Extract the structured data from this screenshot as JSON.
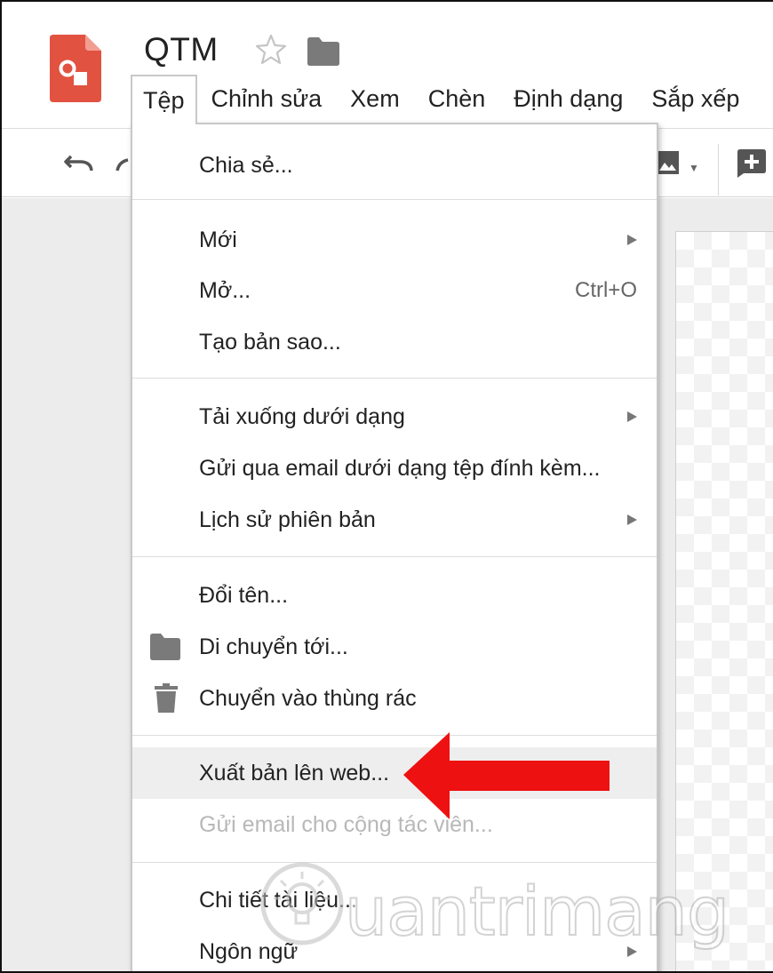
{
  "header": {
    "doc_title": "QTM",
    "icons": [
      "slides-logo-icon",
      "star-icon",
      "folder-icon"
    ]
  },
  "menubar": {
    "items": [
      {
        "label": "Tệp",
        "active": true
      },
      {
        "label": "Chỉnh sửa"
      },
      {
        "label": "Xem"
      },
      {
        "label": "Chèn"
      },
      {
        "label": "Định dạng"
      },
      {
        "label": "Sắp xếp"
      }
    ]
  },
  "toolbar": {
    "icons": [
      "undo-icon",
      "redo-icon",
      "image-icon",
      "add-comment-icon"
    ]
  },
  "file_menu": {
    "share": "Chia sẻ...",
    "new": "Mới",
    "open": "Mở...",
    "open_shortcut": "Ctrl+O",
    "make_copy": "Tạo bản sao...",
    "download_as": "Tải xuống dưới dạng",
    "email_attachment": "Gửi qua email dưới dạng tệp đính kèm...",
    "version_history": "Lịch sử phiên bản",
    "rename": "Đổi tên...",
    "move_to": "Di chuyển tới...",
    "move_to_trash": "Chuyển vào thùng rác",
    "publish_to_web": "Xuất bản lên web...",
    "email_collaborators": "Gửi email cho cộng tác viên...",
    "document_details": "Chi tiết tài liệu...",
    "language": "Ngôn ngữ"
  },
  "watermark": {
    "text": "uantrimang"
  },
  "colors": {
    "slides_brand": "#e25241",
    "arrow_red": "#ee1111",
    "menu_highlight": "#eeeeee",
    "disabled_text": "#b8b8b8"
  }
}
